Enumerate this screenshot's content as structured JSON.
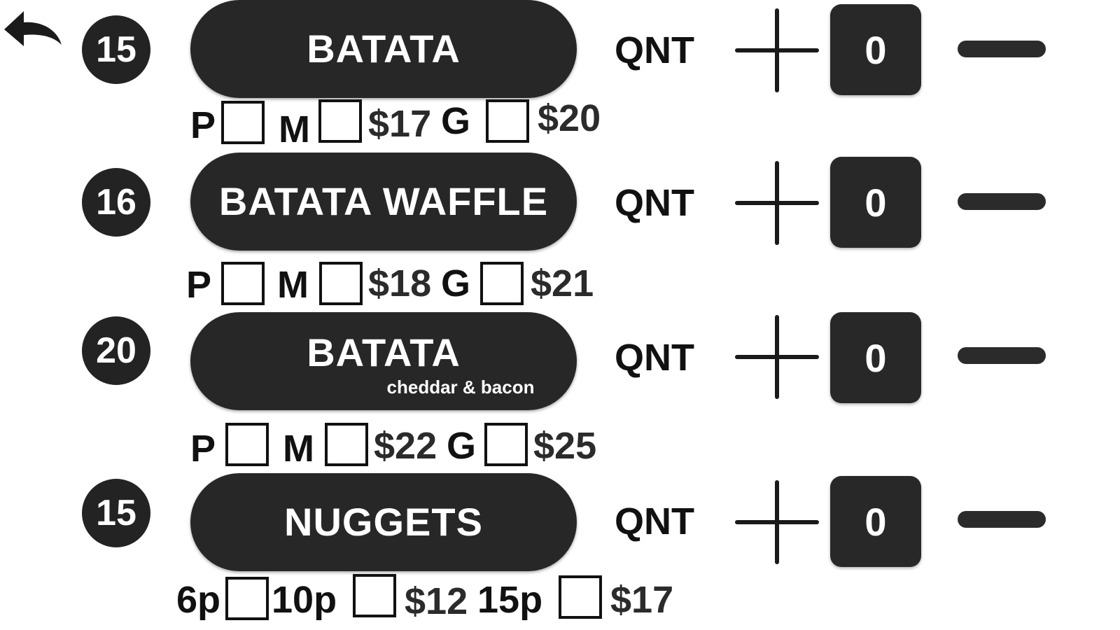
{
  "navigation": {
    "back_icon": "back-arrow-icon"
  },
  "items": [
    {
      "number": "15",
      "name": "BATATA",
      "subtitle": "",
      "qnt_label": "QNT",
      "quantity": "0",
      "sizes": [
        {
          "label": "P",
          "price": ""
        },
        {
          "label": "M",
          "price": "$17"
        },
        {
          "label": "G",
          "price": "$20"
        }
      ]
    },
    {
      "number": "16",
      "name": "BATATA WAFFLE",
      "subtitle": "",
      "qnt_label": "QNT",
      "quantity": "0",
      "sizes": [
        {
          "label": "P",
          "price": ""
        },
        {
          "label": "M",
          "price": "$18"
        },
        {
          "label": "G",
          "price": "$21"
        }
      ]
    },
    {
      "number": "20",
      "name": "BATATA",
      "subtitle": "cheddar & bacon",
      "qnt_label": "QNT",
      "quantity": "0",
      "sizes": [
        {
          "label": "P",
          "price": ""
        },
        {
          "label": "M",
          "price": "$22"
        },
        {
          "label": "G",
          "price": "$25"
        }
      ]
    },
    {
      "number": "15",
      "name": "NUGGETS",
      "subtitle": "",
      "qnt_label": "QNT",
      "quantity": "0",
      "sizes": [
        {
          "label": "6p",
          "price": ""
        },
        {
          "label": "10p",
          "price": "$12"
        },
        {
          "label": "15p",
          "price": "$17"
        }
      ]
    }
  ],
  "colors": {
    "dark": "#272727",
    "background": "#ffffff",
    "text": "#111111"
  }
}
